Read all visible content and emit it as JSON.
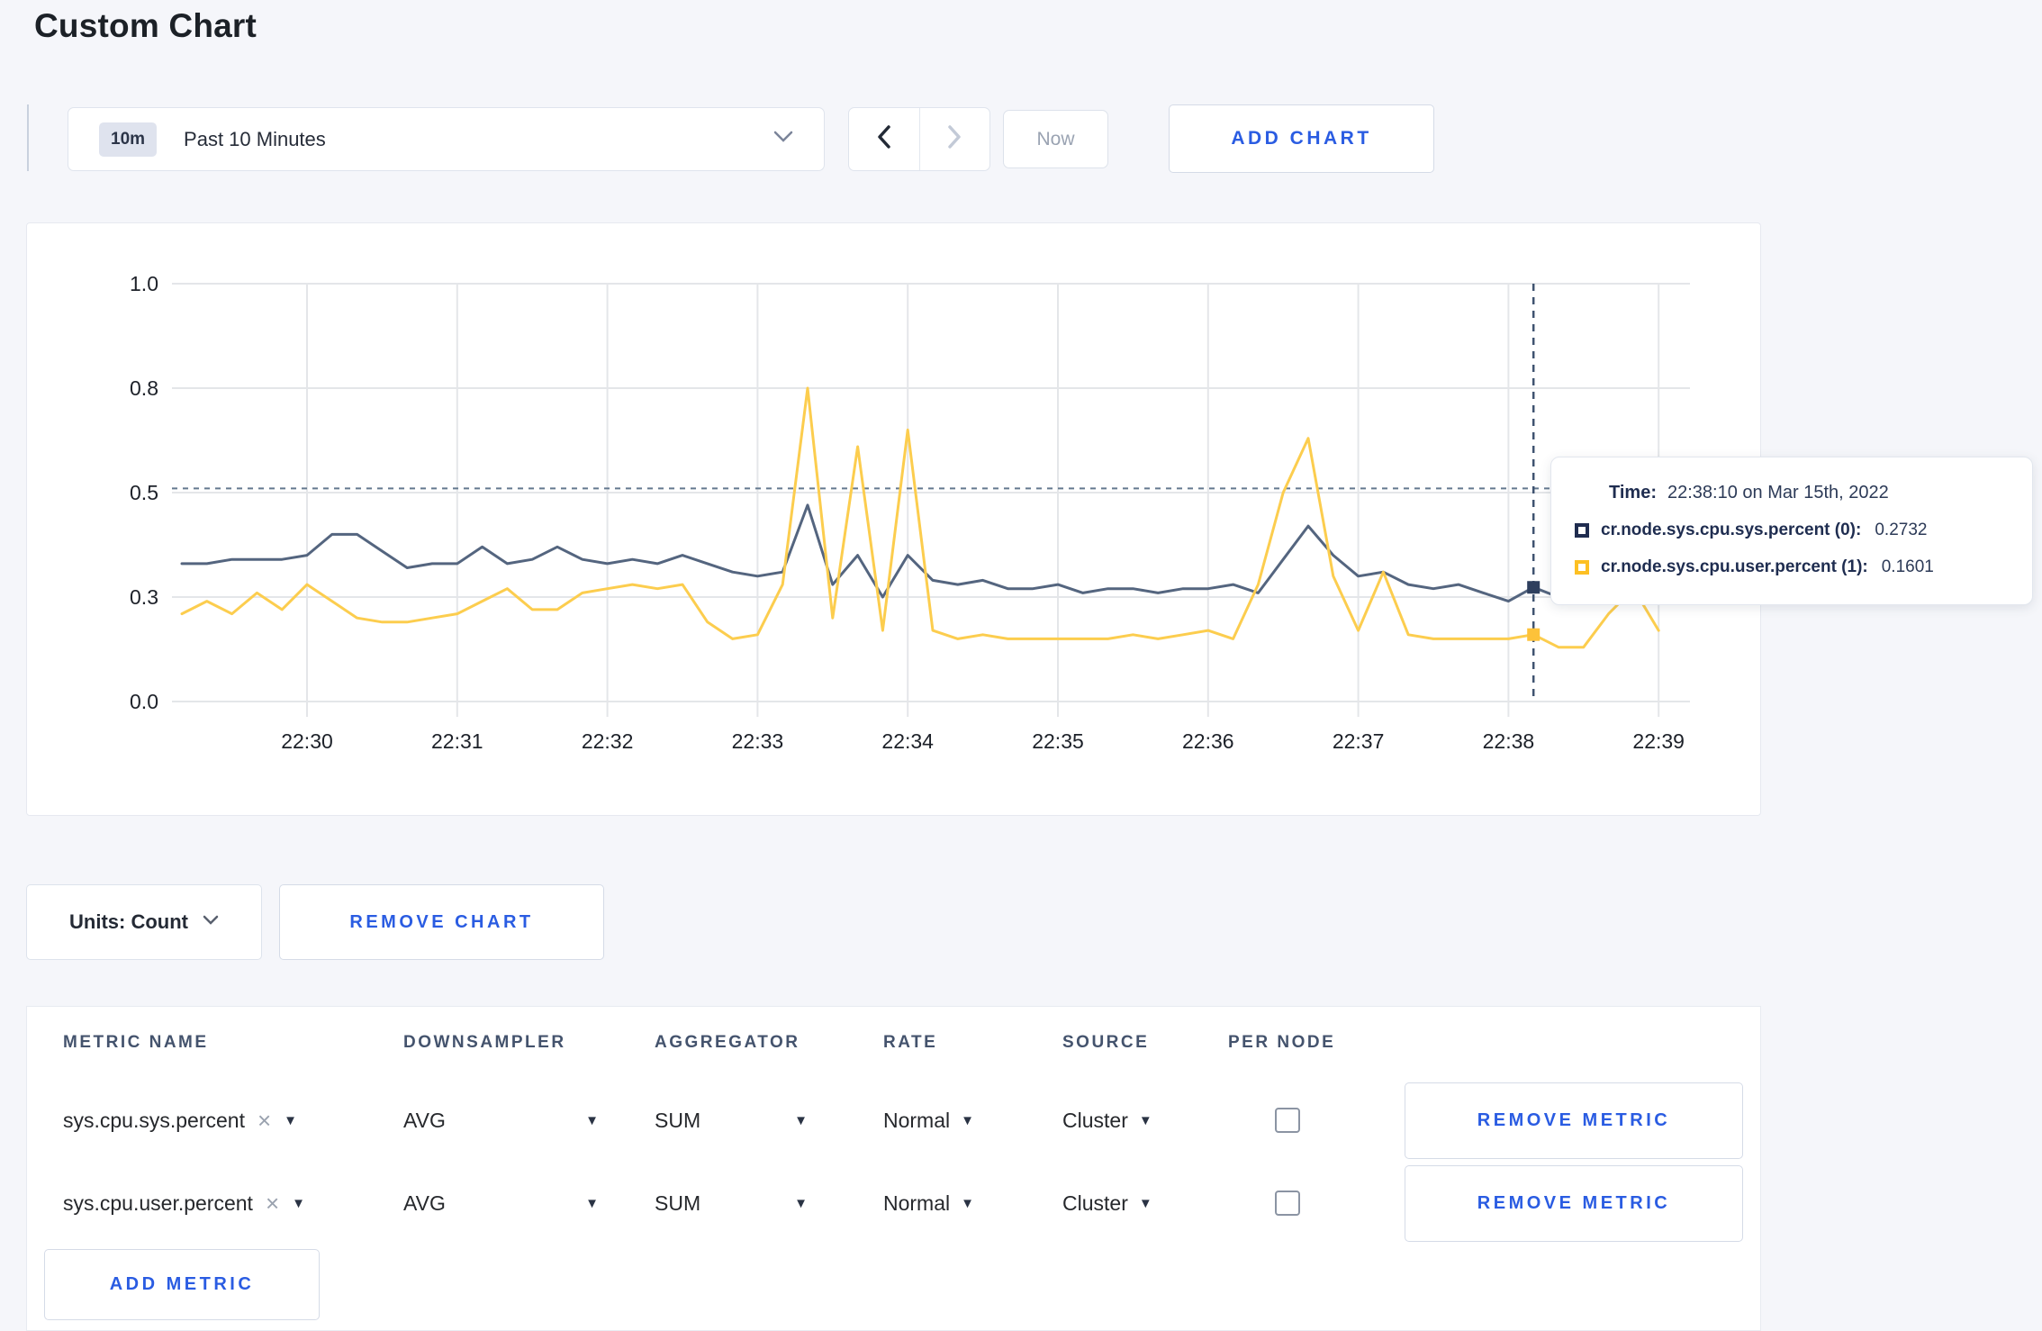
{
  "page": {
    "title": "Custom Chart"
  },
  "colors": {
    "accent_blue": "#2a5ce2",
    "series_sys_line": "#54657f",
    "series_sys_swatch": "#1f2c4f",
    "series_user_line": "#fccd4e",
    "series_user_swatch": "#fdc023",
    "gridline": "#e4e6e9",
    "crosshair": "#3f5370",
    "guideline": "#64798f"
  },
  "toolbar": {
    "time_range": {
      "badge": "10m",
      "label": "Past 10 Minutes"
    },
    "now_label": "Now",
    "add_chart_label": "ADD CHART"
  },
  "tooltip": {
    "time_label": "Time:",
    "time_value": "22:38:10 on Mar 15th, 2022",
    "series": [
      {
        "name": "cr.node.sys.cpu.sys.percent (0):",
        "value": "0.2732",
        "swatch": "#1f2c4f"
      },
      {
        "name": "cr.node.sys.cpu.user.percent (1):",
        "value": "0.1601",
        "swatch": "#fdc023"
      }
    ]
  },
  "units": {
    "label": "Units: Count",
    "remove_chart_label": "REMOVE CHART"
  },
  "metrics_table": {
    "headers": [
      "METRIC NAME",
      "DOWNSAMPLER",
      "AGGREGATOR",
      "RATE",
      "SOURCE",
      "PER NODE"
    ],
    "rows": [
      {
        "metric": "sys.cpu.sys.percent",
        "downsampler": "AVG",
        "aggregator": "SUM",
        "rate": "Normal",
        "source": "Cluster",
        "per_node_checked": false,
        "remove_label": "REMOVE METRIC"
      },
      {
        "metric": "sys.cpu.user.percent",
        "downsampler": "AVG",
        "aggregator": "SUM",
        "rate": "Normal",
        "source": "Cluster",
        "per_node_checked": false,
        "remove_label": "REMOVE METRIC"
      }
    ],
    "add_metric_label": "ADD METRIC"
  },
  "chart_data": {
    "type": "line",
    "title": "",
    "xlabel": "",
    "ylabel": "",
    "ylim": [
      0,
      1
    ],
    "grid": true,
    "x_ticks": [
      "22:30",
      "22:31",
      "22:32",
      "22:33",
      "22:34",
      "22:35",
      "22:36",
      "22:37",
      "22:38",
      "22:39"
    ],
    "y_ticks": [
      {
        "label": "0.0",
        "value": 0
      },
      {
        "label": "0.3",
        "value": 0.25
      },
      {
        "label": "0.5",
        "value": 0.5
      },
      {
        "label": "0.8",
        "value": 0.75
      },
      {
        "label": "1.0",
        "value": 1.0
      }
    ],
    "start_time": "22:29:10",
    "interval_seconds": 10,
    "hover_time": "22:38:10",
    "hover_index": 54,
    "guideline_value": 0.51,
    "series": [
      {
        "name": "cr.node.sys.cpu.sys.percent (0)",
        "color": "#54657f",
        "marker_color": "#2e3f5e",
        "hover_value": 0.2732,
        "values": [
          0.33,
          0.33,
          0.34,
          0.34,
          0.34,
          0.35,
          0.4,
          0.4,
          0.36,
          0.32,
          0.33,
          0.33,
          0.37,
          0.33,
          0.34,
          0.37,
          0.34,
          0.33,
          0.34,
          0.33,
          0.35,
          0.33,
          0.31,
          0.3,
          0.31,
          0.47,
          0.28,
          0.35,
          0.25,
          0.35,
          0.29,
          0.28,
          0.29,
          0.27,
          0.27,
          0.28,
          0.26,
          0.27,
          0.27,
          0.26,
          0.27,
          0.27,
          0.28,
          0.26,
          0.34,
          0.42,
          0.35,
          0.3,
          0.31,
          0.28,
          0.27,
          0.28,
          0.26,
          0.24,
          0.2732,
          0.25,
          0.26,
          0.27,
          0.28,
          0.28
        ]
      },
      {
        "name": "cr.node.sys.cpu.user.percent (1)",
        "color": "#fccd4e",
        "marker_color": "#fdc23a",
        "hover_value": 0.1601,
        "values": [
          0.21,
          0.24,
          0.21,
          0.26,
          0.22,
          0.28,
          0.24,
          0.2,
          0.19,
          0.19,
          0.2,
          0.21,
          0.24,
          0.27,
          0.22,
          0.22,
          0.26,
          0.27,
          0.28,
          0.27,
          0.28,
          0.19,
          0.15,
          0.16,
          0.28,
          0.75,
          0.2,
          0.61,
          0.17,
          0.65,
          0.17,
          0.15,
          0.16,
          0.15,
          0.15,
          0.15,
          0.15,
          0.15,
          0.16,
          0.15,
          0.16,
          0.17,
          0.15,
          0.28,
          0.5,
          0.63,
          0.3,
          0.17,
          0.31,
          0.16,
          0.15,
          0.15,
          0.15,
          0.15,
          0.1601,
          0.13,
          0.13,
          0.21,
          0.27,
          0.17
        ]
      }
    ]
  }
}
